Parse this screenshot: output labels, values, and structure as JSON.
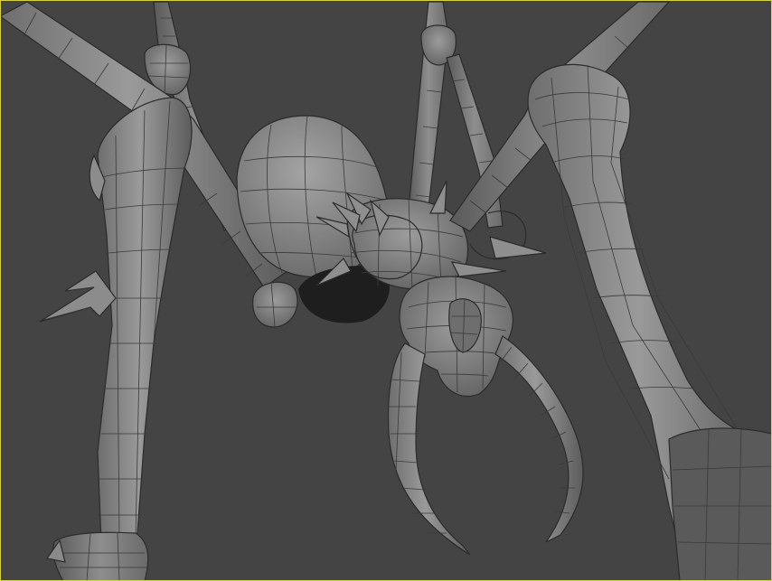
{
  "viewport": {
    "background": "#444444",
    "active_border_color": "#d8d240",
    "model_color": "#8c8c8c",
    "wire_color": "#3a3a3a"
  }
}
